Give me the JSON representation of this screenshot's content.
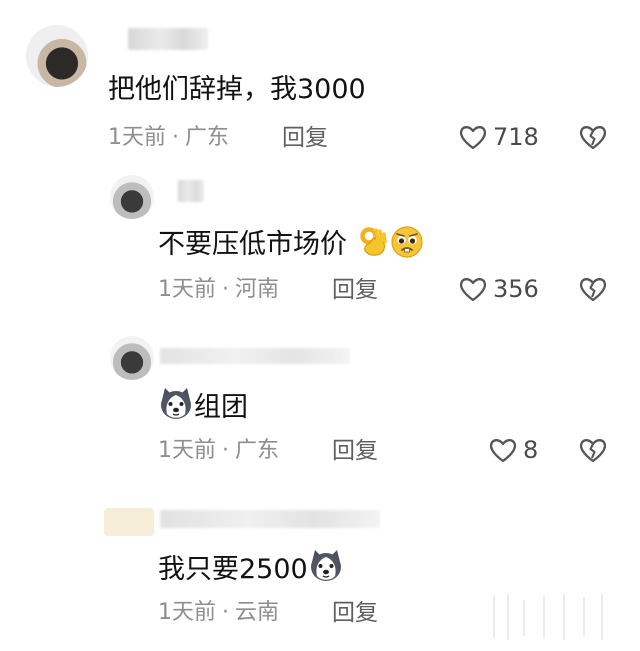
{
  "comments": [
    {
      "text": "把他们辞掉，我3000",
      "time": "1天前",
      "location": "广东",
      "reply": "回复",
      "likes": "718"
    },
    {
      "text": "不要压低市场价",
      "time": "1天前",
      "location": "河南",
      "reply": "回复",
      "likes": "356"
    },
    {
      "text": "组团",
      "time": "1天前",
      "location": "广东",
      "reply": "回复",
      "likes": "8"
    },
    {
      "text": "我只要2500",
      "time": "1天前",
      "location": "云南",
      "reply": "回复"
    }
  ],
  "separator": "·",
  "icons": {
    "like": "heart-outline-icon",
    "dislike": "broken-heart-icon",
    "emoji_ok": "ok-hand-emoji",
    "emoji_plead": "pleading-face-emoji",
    "emoji_husky": "husky-dog-emoji"
  },
  "colors": {
    "text": "#121212",
    "meta": "#8e8e8e",
    "action": "#5f5f5f"
  }
}
